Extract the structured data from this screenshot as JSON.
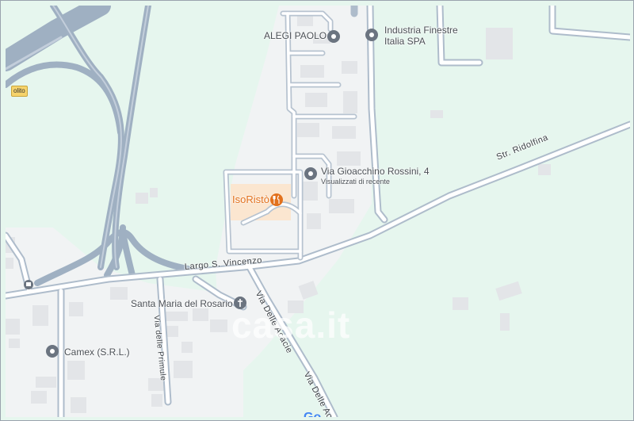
{
  "map": {
    "colors": {
      "park": "#e6f6ee",
      "urban": "#f1f3f4",
      "road_fill": "#ffffff",
      "road_casing": "#aebccb",
      "highway": "#9fb0c2",
      "building": "#e3e5e8",
      "pin": "#6b7480",
      "restaurant": "#e2711d"
    },
    "places": [
      {
        "id": "alegi",
        "name": "ALEGI PAOLO",
        "icon": "map-pin-icon"
      },
      {
        "id": "industria",
        "name": "Industria Finestre",
        "name2": "Italia SPA",
        "icon": "map-pin-icon"
      },
      {
        "id": "rossini",
        "name": "Via Gioacchino Rossini, 4",
        "subtitle": "Visualizzati di recente",
        "icon": "map-pin-icon"
      },
      {
        "id": "santa-maria",
        "name": "Santa Maria del Rosario",
        "icon": "church-pin-icon"
      },
      {
        "id": "camex",
        "name": "Camex (S.R.L.)",
        "icon": "map-pin-icon"
      }
    ],
    "restaurant": {
      "name": "IsoRistò",
      "icon": "restaurant-icon"
    },
    "roads": {
      "largo": "Largo S. Vincenzo",
      "ridolfina": "Str. Ridolfina",
      "acacie_1": "Via Delle Acacie",
      "acacie_2": "Via Delle Aca",
      "primule": "Via delle Primule"
    },
    "road_shield": "olito",
    "watermark": "casa.it",
    "google_logo": "Go"
  }
}
